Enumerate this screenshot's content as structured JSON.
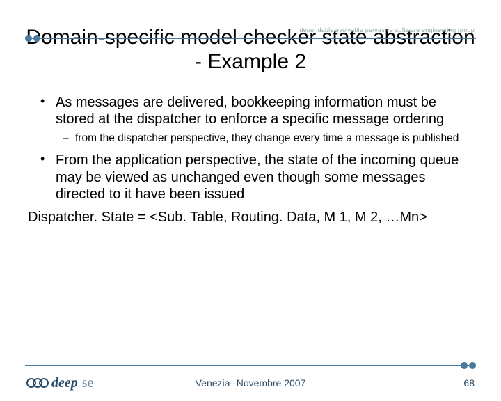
{
  "header": {
    "group_tag": "dependable evolvable pervasive software engineering group"
  },
  "title": "Domain-specific model checker state abstraction - Example 2",
  "bullets": [
    {
      "text": "As messages are delivered, bookkeeping information must be stored at the dispatcher to enforce a specific message ordering",
      "sub": [
        "from the dispatcher perspective, they change every time a message is published"
      ]
    },
    {
      "text": "From the application perspective, the state of the incoming queue may be viewed as unchanged even though some messages directed to it have been issued",
      "sub": []
    }
  ],
  "dispatcher_line": "Dispatcher. State  =  <Sub. Table, Routing. Data, M 1, M 2, …Mn>",
  "footer": {
    "logo_text": "deep",
    "logo_suffix": "se",
    "venue": "Venezia--Novembre 2007",
    "page": "68"
  }
}
